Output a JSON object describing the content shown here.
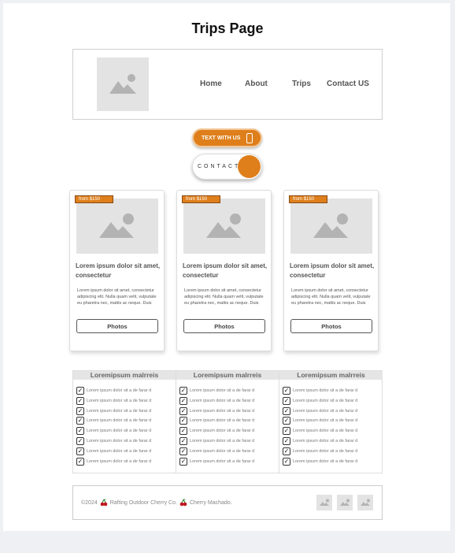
{
  "page": {
    "title": "Trips Page"
  },
  "nav": {
    "home": "Home",
    "about": "About",
    "trips": "Trips",
    "contact": "Contact US"
  },
  "buttons": {
    "text_with_us": "TEXT WITH US",
    "contact": "CONTACT"
  },
  "cards": [
    {
      "badge": "from $150",
      "title": "Lorem ipsum dolor sit amet, consectetur",
      "body": "Lorem ipsum dolor sit amet, consectetur adipiscing elit. Nulla quam velit, vulputate eu pharetra nec, mattis ac neque. Duis",
      "button": "Photos"
    },
    {
      "badge": "from $150",
      "title": "Lorem ipsum dolor sit amet, consectetur",
      "body": "Lorem ipsum dolor sit amet, consectetur adipiscing elit. Nulla quam velit, vulputate eu pharetra nec, mattis ac neque. Duis",
      "button": "Photos"
    },
    {
      "badge": "from $150",
      "title": "Lorem ipsum dolor sit amet, consectetur",
      "body": "Lorem ipsum dolor sit amet, consectetur adipiscing elit. Nulla quam velit, vulputate eu pharetra nec, mattis ac neque. Duis",
      "button": "Photos"
    }
  ],
  "table": {
    "headers": [
      "Loremipsum malrreis",
      "Loremipsum malrreis",
      "Loremipsum malrreis"
    ],
    "row_text": "Lorem ipsum dolor sit a de  farar  d",
    "checked": "✓"
  },
  "footer": {
    "copyright": "©2024",
    "company": "Rafting Outdoor Cherry Co.",
    "author": "Cherry Machado."
  },
  "icons": {
    "placeholder": "image-placeholder-icon",
    "cherry": "cherry-icon",
    "phone": "phone-icon"
  },
  "colors": {
    "accent": "#de7f1c",
    "placeholder": "#e3e3e3",
    "icon": "#b3b3b3"
  }
}
